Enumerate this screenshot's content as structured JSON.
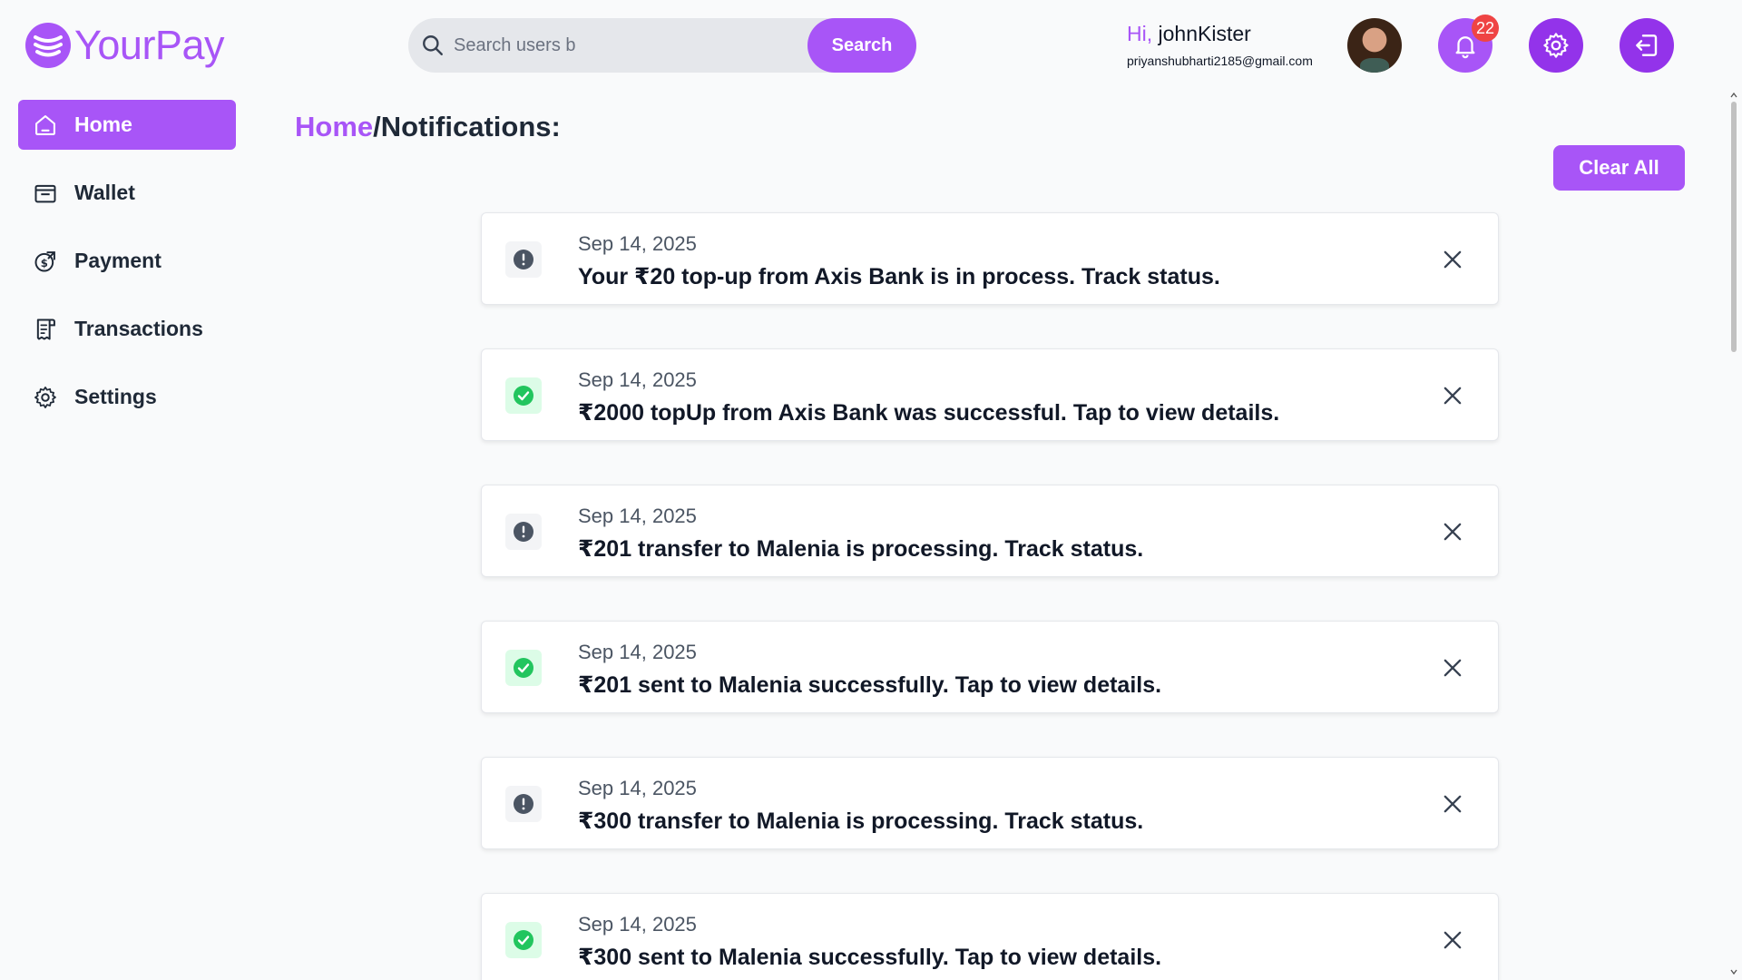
{
  "app": {
    "name": "YourPay"
  },
  "search": {
    "placeholder": "Search users b",
    "button_label": "Search"
  },
  "user": {
    "greeting": "Hi,",
    "username": "johnKister",
    "email": "priyanshubharti2185@gmail.com"
  },
  "notifications_badge": "22",
  "sidebar": {
    "items": [
      {
        "label": "Home",
        "icon": "home-icon",
        "active": true
      },
      {
        "label": "Wallet",
        "icon": "wallet-icon"
      },
      {
        "label": "Payment",
        "icon": "payment-icon"
      },
      {
        "label": "Transactions",
        "icon": "receipt-icon"
      },
      {
        "label": "Settings",
        "icon": "gear-icon"
      }
    ]
  },
  "breadcrumb": {
    "parent": "Home",
    "separator": "/",
    "current": "Notifications:"
  },
  "clear_all_label": "Clear All",
  "notifications": [
    {
      "status": "pending",
      "date": "Sep 14, 2025",
      "message": "Your ₹20 top-up from Axis Bank is in process. Track status."
    },
    {
      "status": "success",
      "date": "Sep 14, 2025",
      "message": "₹2000 topUp from Axis Bank was successful. Tap to view details."
    },
    {
      "status": "pending",
      "date": "Sep 14, 2025",
      "message": "₹201 transfer to Malenia is processing. Track status."
    },
    {
      "status": "success",
      "date": "Sep 14, 2025",
      "message": "₹201 sent to Malenia successfully. Tap to view details."
    },
    {
      "status": "pending",
      "date": "Sep 14, 2025",
      "message": "₹300 transfer to Malenia is processing. Track status."
    },
    {
      "status": "success",
      "date": "Sep 14, 2025",
      "message": "₹300 sent to Malenia successfully. Tap to view details."
    }
  ],
  "colors": {
    "accent": "#a855f7",
    "accent_dark": "#9333ea",
    "badge": "#ef4444",
    "success": "#22c55e",
    "pending": "#6b7280"
  }
}
